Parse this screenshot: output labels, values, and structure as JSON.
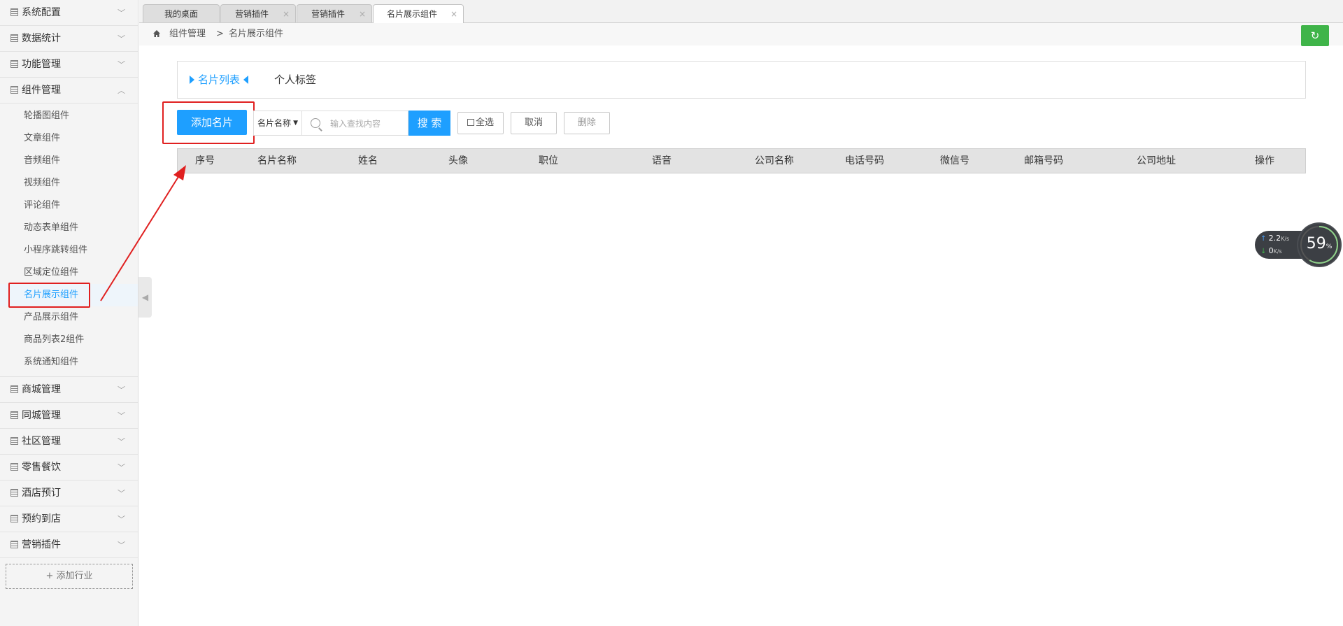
{
  "sidebar": {
    "groups_top": [
      {
        "label": "系统配置"
      },
      {
        "label": "数据统计"
      },
      {
        "label": "功能管理"
      }
    ],
    "open_group": {
      "label": "组件管理",
      "items": [
        {
          "label": "轮播图组件"
        },
        {
          "label": "文章组件"
        },
        {
          "label": "音频组件"
        },
        {
          "label": "视频组件"
        },
        {
          "label": "评论组件"
        },
        {
          "label": "动态表单组件"
        },
        {
          "label": "小程序跳转组件"
        },
        {
          "label": "区域定位组件"
        },
        {
          "label": "名片展示组件"
        },
        {
          "label": "产品展示组件"
        },
        {
          "label": "商品列表2组件"
        },
        {
          "label": "系统通知组件"
        }
      ]
    },
    "groups_bottom": [
      {
        "label": "商城管理"
      },
      {
        "label": "同城管理"
      },
      {
        "label": "社区管理"
      },
      {
        "label": "零售餐饮"
      },
      {
        "label": "酒店预订"
      },
      {
        "label": "预约到店"
      },
      {
        "label": "营销插件"
      }
    ],
    "add_industry": "+ 添加行业"
  },
  "tabs": [
    {
      "label": "我的桌面"
    },
    {
      "label": "营销插件",
      "close": "×"
    },
    {
      "label": "营销插件",
      "close": "×"
    },
    {
      "label": "名片展示组件",
      "close": "×"
    }
  ],
  "breadcrumb": {
    "parent": "组件管理",
    "separator": ">",
    "current": "名片展示组件"
  },
  "subtabs": {
    "active": "名片列表",
    "other": "个人标签"
  },
  "toolbar": {
    "add_label": "添加名片",
    "select_value": "名片名称",
    "search_placeholder": "输入查找内容",
    "search_label": "搜 索",
    "select_all_label": "全选",
    "cancel_label": "取消",
    "delete_label": "删除"
  },
  "table": {
    "columns": [
      "序号",
      "名片名称",
      "姓名",
      "头像",
      "职位",
      "语音",
      "公司名称",
      "电话号码",
      "微信号",
      "邮箱号码",
      "公司地址",
      "操作"
    ]
  },
  "net_widget": {
    "up_value": "2.2",
    "up_unit": "K/s",
    "down_value": "0",
    "down_unit": "K/s",
    "percent": "59",
    "percent_unit": "%"
  },
  "colors": {
    "accent": "#1e9fff",
    "refresh": "#3fb449",
    "highlight": "#e02020"
  }
}
